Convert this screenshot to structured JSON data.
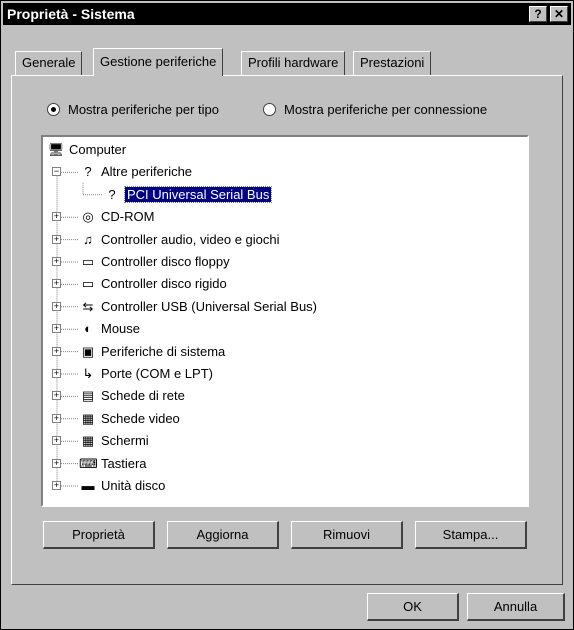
{
  "window": {
    "title": "Proprietà - Sistema",
    "help_label": "?",
    "close_label": "✕"
  },
  "tabs": [
    {
      "label": "Generale"
    },
    {
      "label": "Gestione periferiche"
    },
    {
      "label": "Profili hardware"
    },
    {
      "label": "Prestazioni"
    }
  ],
  "view_options": {
    "by_type": "Mostra periferiche per tipo",
    "by_connection": "Mostra periferiche per connessione",
    "selected": "by_type"
  },
  "tree": [
    {
      "label": "Computer",
      "icon": "computer-icon",
      "glyph": "🖥",
      "expand": ""
    },
    {
      "label": "Altre periferiche",
      "icon": "unknown-device-icon",
      "glyph": "?",
      "expand": "−"
    },
    {
      "label": "PCI Universal Serial Bus",
      "icon": "unknown-device-icon",
      "glyph": "?",
      "expand": "",
      "selected": true
    },
    {
      "label": "CD-ROM",
      "icon": "cdrom-icon",
      "glyph": "◎",
      "expand": "+"
    },
    {
      "label": "Controller audio, video e giochi",
      "icon": "multimedia-icon",
      "glyph": "♫",
      "expand": "+"
    },
    {
      "label": "Controller disco floppy",
      "icon": "floppy-controller-icon",
      "glyph": "▭",
      "expand": "+"
    },
    {
      "label": "Controller disco rigido",
      "icon": "hard-disk-controller-icon",
      "glyph": "▭",
      "expand": "+"
    },
    {
      "label": "Controller USB (Universal Serial Bus)",
      "icon": "usb-icon",
      "glyph": "⇆",
      "expand": "+"
    },
    {
      "label": "Mouse",
      "icon": "mouse-icon",
      "glyph": "◐",
      "expand": "+"
    },
    {
      "label": "Periferiche di sistema",
      "icon": "system-device-icon",
      "glyph": "▣",
      "expand": "+"
    },
    {
      "label": "Porte (COM e LPT)",
      "icon": "port-icon",
      "glyph": "↳",
      "expand": "+"
    },
    {
      "label": "Schede di rete",
      "icon": "network-card-icon",
      "glyph": "▤",
      "expand": "+"
    },
    {
      "label": "Schede video",
      "icon": "display-adapter-icon",
      "glyph": "▦",
      "expand": "+"
    },
    {
      "label": "Schermi",
      "icon": "monitor-icon",
      "glyph": "▦",
      "expand": "+"
    },
    {
      "label": "Tastiera",
      "icon": "keyboard-icon",
      "glyph": "⌨",
      "expand": "+"
    },
    {
      "label": "Unità disco",
      "icon": "disk-drive-icon",
      "glyph": "▬",
      "expand": "+"
    }
  ],
  "buttons": {
    "properties": "Proprietà",
    "refresh": "Aggiorna",
    "remove": "Rimuovi",
    "print": "Stampa...",
    "ok": "OK",
    "cancel": "Annulla"
  },
  "colors": {
    "selection": "#000080",
    "face": "#c0c0c0"
  }
}
